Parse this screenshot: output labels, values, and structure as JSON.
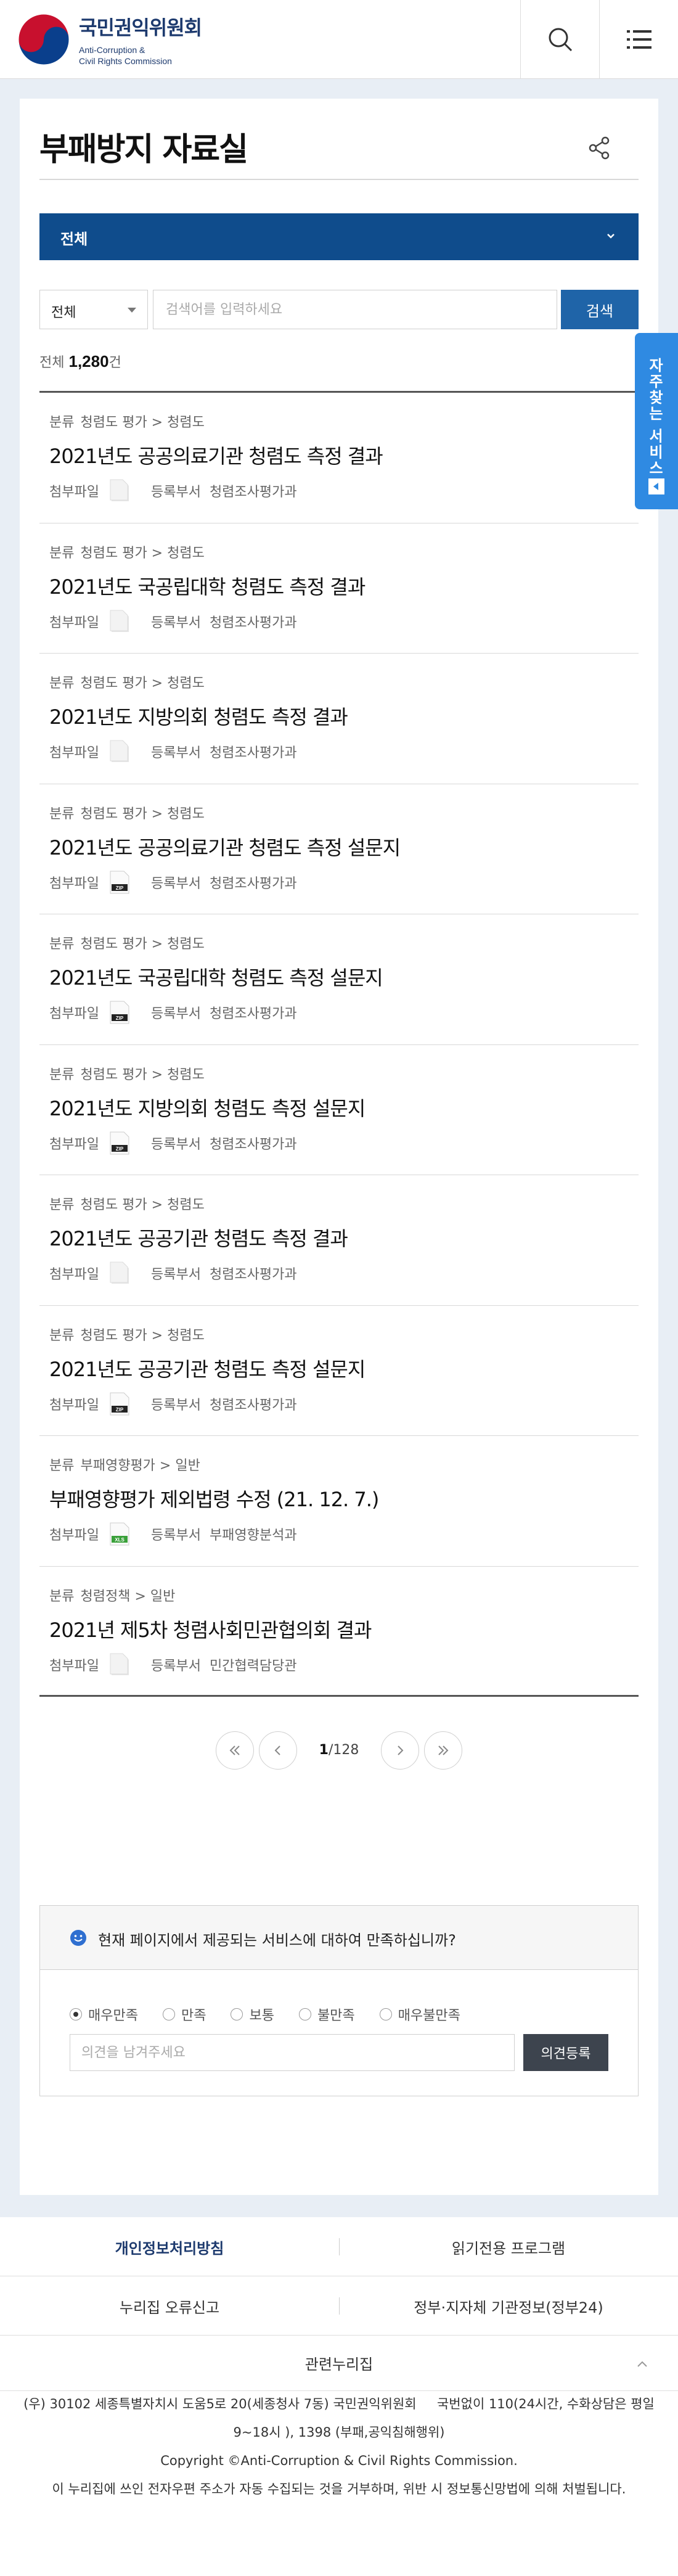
{
  "header": {
    "logo_title": "국민권익위원회",
    "logo_sub1": "Anti-Corruption &",
    "logo_sub2": "Civil Rights Commission",
    "search_icon": "search-icon",
    "menu_icon": "menu-icon"
  },
  "page": {
    "title": "부패방지 자료실",
    "share_icon": "share-icon"
  },
  "category": {
    "selected": "전체",
    "icon": "chevron-down-icon"
  },
  "search": {
    "field_selected": "전체",
    "placeholder": "검색어를 입력하세요",
    "button": "검색"
  },
  "count": {
    "label": "전체",
    "value": "1,280",
    "unit": "건"
  },
  "list_labels": {
    "category": "분류",
    "attachment": "첨부파일",
    "department": "등록부서"
  },
  "items": [
    {
      "category": "청렴도 평가 > 청렴도",
      "title": "2021년도 공공의료기관 청렴도 측정 결과",
      "file_type": "file",
      "department": "청렴조사평가과"
    },
    {
      "category": "청렴도 평가 > 청렴도",
      "title": "2021년도 국공립대학 청렴도 측정 결과",
      "file_type": "file",
      "department": "청렴조사평가과"
    },
    {
      "category": "청렴도 평가 > 청렴도",
      "title": "2021년도 지방의회 청렴도 측정 결과",
      "file_type": "file",
      "department": "청렴조사평가과"
    },
    {
      "category": "청렴도 평가 > 청렴도",
      "title": "2021년도 공공의료기관 청렴도 측정 설문지",
      "file_type": "zip",
      "department": "청렴조사평가과"
    },
    {
      "category": "청렴도 평가 > 청렴도",
      "title": "2021년도 국공립대학 청렴도 측정 설문지",
      "file_type": "zip",
      "department": "청렴조사평가과"
    },
    {
      "category": "청렴도 평가 > 청렴도",
      "title": "2021년도 지방의회 청렴도 측정 설문지",
      "file_type": "zip",
      "department": "청렴조사평가과"
    },
    {
      "category": "청렴도 평가 > 청렴도",
      "title": "2021년도 공공기관 청렴도 측정 결과",
      "file_type": "file",
      "department": "청렴조사평가과"
    },
    {
      "category": "청렴도 평가 > 청렴도",
      "title": "2021년도 공공기관 청렴도 측정 설문지",
      "file_type": "zip",
      "department": "청렴조사평가과"
    },
    {
      "category": "부패영향평가 > 일반",
      "title": "부패영향평가 제외법령 수정 (21. 12. 7.)",
      "file_type": "xls",
      "department": "부패영향분석과"
    },
    {
      "category": "청렴정책 > 일반",
      "title": "2021년 제5차 청렴사회민관협의회 결과",
      "file_type": "file",
      "department": "민간협력담당관"
    }
  ],
  "file_badges": {
    "zip": "ZIP",
    "xls": "XLS"
  },
  "pagination": {
    "current": "1",
    "total": "128",
    "first_icon": "double-chevron-left-icon",
    "prev_icon": "chevron-left-icon",
    "next_icon": "chevron-right-icon",
    "last_icon": "double-chevron-right-icon"
  },
  "survey": {
    "question": "현재 페이지에서 제공되는 서비스에 대하여 만족하십니까?",
    "options": [
      "매우만족",
      "만족",
      "보통",
      "불만족",
      "매우불만족"
    ],
    "selected_index": 0,
    "placeholder": "의견을 남겨주세요",
    "button": "의견등록"
  },
  "quick_menu": {
    "label": "자주찾는 서비스"
  },
  "footer": {
    "privacy": "개인정보처리방침",
    "reader": "읽기전용 프로그램",
    "error_report": "누리집 오류신고",
    "gov_info": "정부·지자체 기관정보(정부24)",
    "related": "관련누리집",
    "address": "(우) 30102 세종특별자치시 도움5로 20(세종청사 7동) 국민권익위원회",
    "phone1": "국번없이 110(24시간, 수화상담은 평일",
    "phone2": "9~18시 ), 1398 (부패,공익침해행위)",
    "copyright": "Copyright ©Anti-Corruption & Civil Rights Commission.",
    "notice": "이 누리집에 쓰인 전자우편 주소가 자동 수집되는 것을 거부하며, 위반 시 정보통신망법에 의해 처벌됩니다."
  },
  "colors": {
    "brand_navy": "#1d3a6e",
    "category_bar": "#0f4c8c",
    "search_button": "#1f64a8",
    "quick_menu": "#2f8ae2",
    "submit_button": "#3d444e"
  }
}
